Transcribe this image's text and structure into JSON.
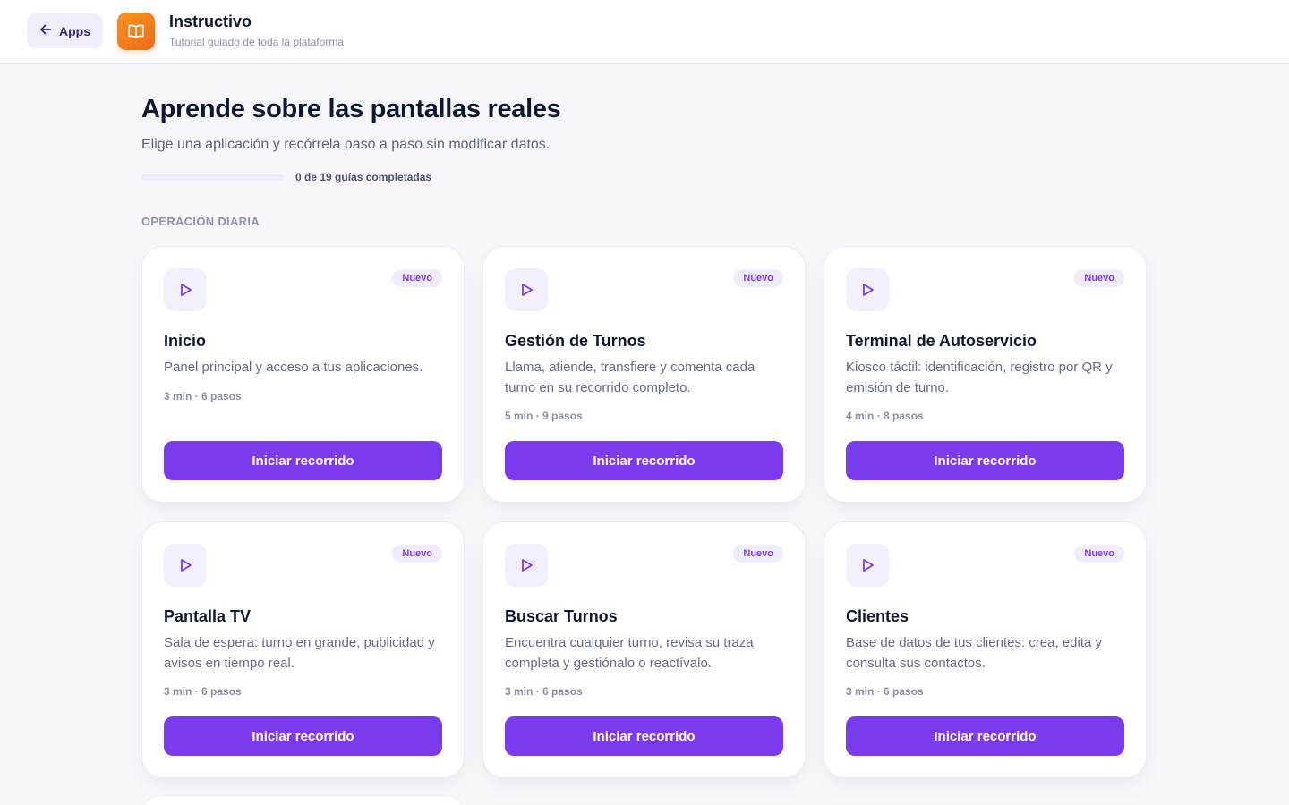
{
  "header": {
    "back_label": "Apps",
    "app_title": "Instructivo",
    "app_subtitle": "Tutorial guiado de toda la plataforma"
  },
  "main": {
    "heading": "Aprende sobre las pantallas reales",
    "description": "Elige una aplicación y recórrela paso a paso sin modificar datos.",
    "progress": {
      "completed": 0,
      "total": 19,
      "fraction": 0.0,
      "label": "0 de 19 guías completadas"
    },
    "section_label": "OPERACIÓN DIARIA"
  },
  "cards": [
    {
      "title": "Inicio",
      "description": "Panel principal y acceso a tus aplicaciones.",
      "meta": "3 min · 6 pasos",
      "badge": "Nuevo",
      "button": "Iniciar recorrido"
    },
    {
      "title": "Gestión de Turnos",
      "description": "Llama, atiende, transfiere y comenta cada turno en su recorrido completo.",
      "meta": "5 min · 9 pasos",
      "badge": "Nuevo",
      "button": "Iniciar recorrido"
    },
    {
      "title": "Terminal de Autoservicio",
      "description": "Kiosco táctil: identificación, registro por QR y emisión de turno.",
      "meta": "4 min · 8 pasos",
      "badge": "Nuevo",
      "button": "Iniciar recorrido"
    },
    {
      "title": "Pantalla TV",
      "description": "Sala de espera: turno en grande, publicidad y avisos en tiempo real.",
      "meta": "3 min · 6 pasos",
      "badge": "Nuevo",
      "button": "Iniciar recorrido"
    },
    {
      "title": "Buscar Turnos",
      "description": "Encuentra cualquier turno, revisa su traza completa y gestiónalo o reactívalo.",
      "meta": "3 min · 6 pasos",
      "badge": "Nuevo",
      "button": "Iniciar recorrido"
    },
    {
      "title": "Clientes",
      "description": "Base de datos de tus clientes: crea, edita y consulta sus contactos.",
      "meta": "3 min · 6 pasos",
      "badge": "Nuevo",
      "button": "Iniciar recorrido"
    }
  ],
  "colors": {
    "accent": "#7c3aed",
    "logo": "#f7941d",
    "background": "#f8f8fc"
  },
  "icons": {
    "back": "arrow-left-icon",
    "logo": "open-book-icon",
    "card": "play-icon"
  }
}
